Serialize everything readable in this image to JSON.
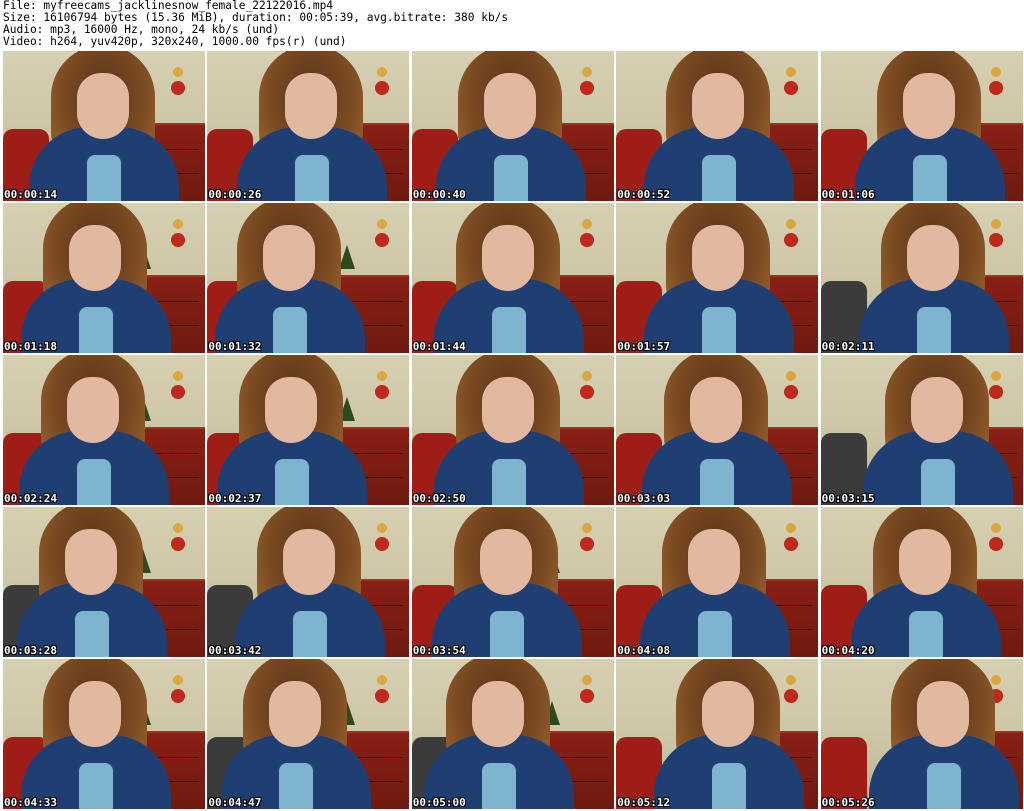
{
  "header": {
    "file_line": "File: myfreecams_jacklinesnow_female_22122016.mp4",
    "size_line": "Size: 16106794 bytes (15.36 MiB), duration: 00:05:39, avg.bitrate: 380 kb/s",
    "audio_line": "Audio: mp3, 16000 Hz, mono, 24 kb/s (und)",
    "video_line": "Video: h264, yuv420p, 320x240, 1000.00 fps(r) (und)"
  },
  "thumbnails": [
    {
      "timestamp": "00:00:14"
    },
    {
      "timestamp": "00:00:26"
    },
    {
      "timestamp": "00:00:40"
    },
    {
      "timestamp": "00:00:52"
    },
    {
      "timestamp": "00:01:06"
    },
    {
      "timestamp": "00:01:18"
    },
    {
      "timestamp": "00:01:32"
    },
    {
      "timestamp": "00:01:44"
    },
    {
      "timestamp": "00:01:57"
    },
    {
      "timestamp": "00:02:11"
    },
    {
      "timestamp": "00:02:24"
    },
    {
      "timestamp": "00:02:37"
    },
    {
      "timestamp": "00:02:50"
    },
    {
      "timestamp": "00:03:03"
    },
    {
      "timestamp": "00:03:15"
    },
    {
      "timestamp": "00:03:28"
    },
    {
      "timestamp": "00:03:42"
    },
    {
      "timestamp": "00:03:54"
    },
    {
      "timestamp": "00:04:08"
    },
    {
      "timestamp": "00:04:20"
    },
    {
      "timestamp": "00:04:33"
    },
    {
      "timestamp": "00:04:47"
    },
    {
      "timestamp": "00:05:00"
    },
    {
      "timestamp": "00:05:12"
    },
    {
      "timestamp": "00:05:26"
    }
  ],
  "colors": {
    "wall": "#d6d0b2",
    "dresser": "#8a1f14",
    "blazer": "#1f3f73",
    "shirt": "#7fb4cf",
    "hair": "#7a4a22",
    "timestamp_text": "#ffffff"
  }
}
